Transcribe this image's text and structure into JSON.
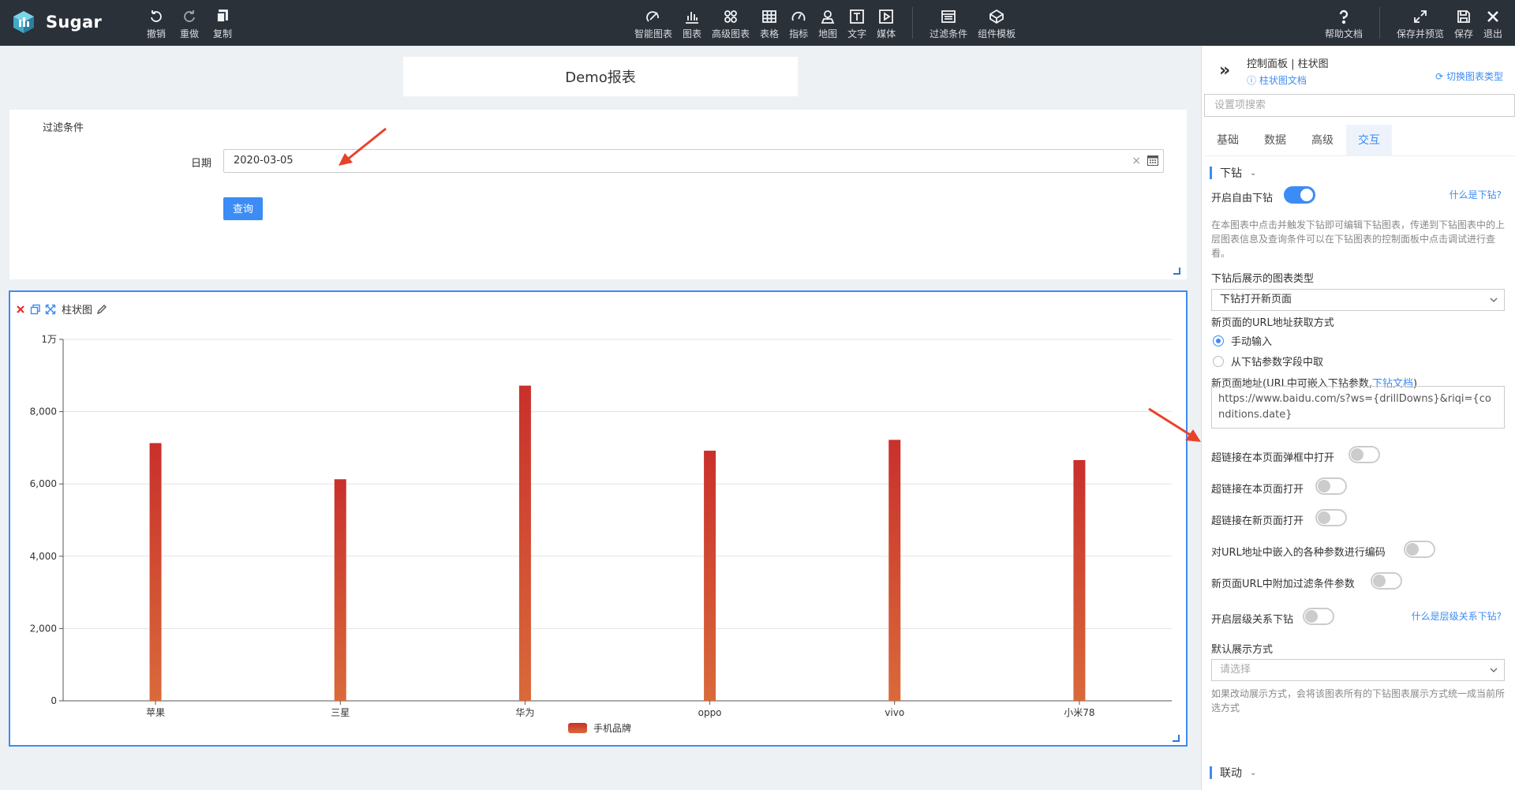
{
  "app": {
    "name": "Sugar"
  },
  "toolbar": {
    "left": [
      {
        "key": "undo",
        "label": "撤销",
        "icon": "undo-icon"
      },
      {
        "key": "redo",
        "label": "重做",
        "icon": "redo-icon"
      },
      {
        "key": "copy",
        "label": "复制",
        "icon": "copy-icon"
      }
    ],
    "center": [
      {
        "key": "smart-chart",
        "label": "智能图表",
        "icon": "smart-chart-icon"
      },
      {
        "key": "chart",
        "label": "图表",
        "icon": "bar-chart-icon"
      },
      {
        "key": "advanced-chart",
        "label": "高级图表",
        "icon": "advanced-chart-icon"
      },
      {
        "key": "table",
        "label": "表格",
        "icon": "table-icon"
      },
      {
        "key": "metric",
        "label": "指标",
        "icon": "gauge-icon"
      },
      {
        "key": "map",
        "label": "地图",
        "icon": "map-pin-icon"
      },
      {
        "key": "text",
        "label": "文字",
        "icon": "text-icon"
      },
      {
        "key": "media",
        "label": "媒体",
        "icon": "media-icon"
      },
      {
        "key": "filter",
        "label": "过滤条件",
        "icon": "filter-icon"
      },
      {
        "key": "template",
        "label": "组件模板",
        "icon": "template-icon"
      }
    ],
    "right": [
      {
        "key": "help",
        "label": "帮助文档",
        "icon": "help-icon"
      },
      {
        "key": "save-preview",
        "label": "保存并预览",
        "icon": "expand-icon"
      },
      {
        "key": "save",
        "label": "保存",
        "icon": "save-icon"
      },
      {
        "key": "exit",
        "label": "退出",
        "icon": "close-icon"
      }
    ]
  },
  "report": {
    "title": "Demo报表"
  },
  "filter": {
    "title": "过滤条件",
    "date_label": "日期",
    "date_value": "2020-03-05",
    "clear_symbol": "×",
    "query_label": "查询"
  },
  "chart_panel": {
    "name": "柱状图"
  },
  "chart_data": {
    "type": "bar",
    "categories": [
      "苹果",
      "三星",
      "华为",
      "oppo",
      "vivo",
      "小米78"
    ],
    "series": [
      {
        "name": "手机品牌",
        "values": [
          7130,
          6130,
          8720,
          6920,
          7220,
          6660
        ]
      }
    ],
    "ylim": [
      0,
      10000
    ],
    "yticks": [
      {
        "value": 0,
        "label": "0"
      },
      {
        "value": 2000,
        "label": "2,000"
      },
      {
        "value": 4000,
        "label": "4,000"
      },
      {
        "value": 6000,
        "label": "6,000"
      },
      {
        "value": 8000,
        "label": "8,000"
      },
      {
        "value": 10000,
        "label": "1万"
      }
    ],
    "grid": true,
    "legend": "bottom-center",
    "colors": {
      "bar_top": "#c9302c",
      "bar_bottom": "#d96a3a"
    }
  },
  "panel": {
    "title": "控制面板 | 柱状图",
    "doc_link": "柱状图文档",
    "switch_link": "切换图表类型",
    "search_placeholder": "设置项搜索",
    "tabs": [
      {
        "label": "基础",
        "active": false
      },
      {
        "label": "数据",
        "active": false
      },
      {
        "label": "高级",
        "active": false
      },
      {
        "label": "交互",
        "active": true
      }
    ],
    "drill": {
      "section": "下钻",
      "free_drill_label": "开启自由下钻",
      "free_drill_on": true,
      "what_is_drill": "什么是下钻?",
      "description": "在本图表中点击并触发下钻即可编辑下钻图表，传递到下钻图表中的上层图表信息及查询条件可以在下钻图表的控制面板中点击调试进行查看。",
      "chart_type_label": "下钻后展示的图表类型",
      "chart_type_value": "下钻打开新页面",
      "url_method_label": "新页面的URL地址获取方式",
      "url_method_options": [
        {
          "label": "手动输入",
          "checked": true
        },
        {
          "label": "从下钻参数字段中取",
          "checked": false
        }
      ],
      "url_label_prefix": "新页面地址(URL中可嵌入下钻参数,",
      "url_label_link": "下钻文档",
      "url_label_suffix": ")",
      "url_value": "https://www.baidu.com/s?ws={drillDowns}&riqi={conditions.date}",
      "toggles": [
        {
          "key": "popup",
          "label": "超链接在本页面弹框中打开",
          "on": false
        },
        {
          "key": "same-page",
          "label": "超链接在本页面打开",
          "on": false
        },
        {
          "key": "new-page",
          "label": "超链接在新页面打开",
          "on": false
        },
        {
          "key": "encode",
          "label": "对URL地址中嵌入的各种参数进行编码",
          "on": false
        },
        {
          "key": "append-filter",
          "label": "新页面URL中附加过滤条件参数",
          "on": false
        }
      ],
      "hierarchy_label": "开启层级关系下钻",
      "hierarchy_on": false,
      "what_is_hierarchy": "什么是层级关系下钻?",
      "display_label": "默认展示方式",
      "display_placeholder": "请选择",
      "display_note": "如果改动展示方式，会将该图表所有的下钻图表展示方式统一成当前所选方式"
    },
    "linkage": {
      "section": "联动"
    }
  },
  "colors": {
    "accent": "#3b8cf5",
    "topbar": "#2b3139",
    "arrow": "#e8432a"
  }
}
